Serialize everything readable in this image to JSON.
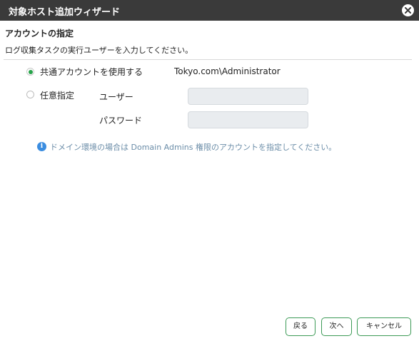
{
  "window": {
    "title": "対象ホスト追加ウィザード"
  },
  "section": {
    "title": "アカウントの指定",
    "description": "ログ収集タスクの実行ユーザーを入力してください。"
  },
  "options": {
    "shared": {
      "label": "共通アカウントを使用する",
      "value": "Tokyo.com\\Administrator",
      "selected": true
    },
    "custom": {
      "label": "任意指定",
      "selected": false
    }
  },
  "fields": {
    "user": {
      "label": "ユーザー",
      "value": ""
    },
    "password": {
      "label": "パスワード",
      "value": ""
    }
  },
  "note": "ドメイン環境の場合は Domain Admins 権限のアカウントを指定してください。",
  "buttons": {
    "back": "戻る",
    "next": "次へ",
    "cancel": "キャンセル"
  },
  "icons": {
    "close": "close-icon",
    "info": "info-icon"
  },
  "colors": {
    "titlebar": "#3a3a3a",
    "accent": "#27a34a",
    "button_border": "#3c9a56",
    "info": "#3b8de0",
    "note_text": "#6b8da8"
  }
}
